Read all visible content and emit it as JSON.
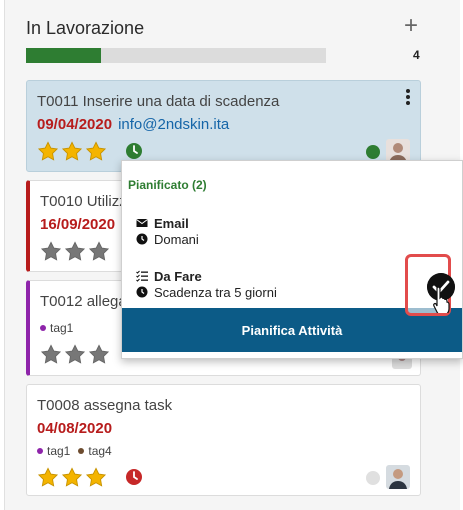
{
  "column": {
    "title": "In Lavorazione",
    "add_icon": "plus-icon",
    "progress": 0.25,
    "count": "4"
  },
  "cards": [
    {
      "code_title": "T0011 Inserire una data di scadenza",
      "date": "09/04/2020",
      "email": "info@2ndskin.ita",
      "stars": 3,
      "star_color": "#f4b400",
      "status_color": "#2e7d32"
    },
    {
      "code_title": "T0010 Utilizz",
      "date": "16/09/2020",
      "stars": 0
    },
    {
      "code_title": "T0012 allega",
      "tags": [
        {
          "label": "tag1",
          "color": "#8e24aa"
        }
      ],
      "stars": 0
    },
    {
      "code_title": "T0008 assegna task",
      "date": "04/08/2020",
      "tags": [
        {
          "label": "tag1",
          "color": "#8e24aa"
        },
        {
          "label": "tag4",
          "color": "#6d4c2f"
        }
      ],
      "stars": 3,
      "clock_color": "#c62828",
      "status_color": "#e0e0e0"
    }
  ],
  "popup": {
    "title": "Pianificato (2)",
    "activities": [
      {
        "type": "Email",
        "icon": "envelope-icon",
        "when": "Domani"
      },
      {
        "type": "Da Fare",
        "icon": "checklist-icon",
        "when": "Scadenza tra 5 giorni"
      }
    ],
    "button": "Pianifica Attività"
  },
  "colors": {
    "accent_green": "#2e7d32",
    "accent_red": "#b71c1c",
    "primary_blue": "#0c5b87",
    "highlight_red": "#e24c4c"
  }
}
